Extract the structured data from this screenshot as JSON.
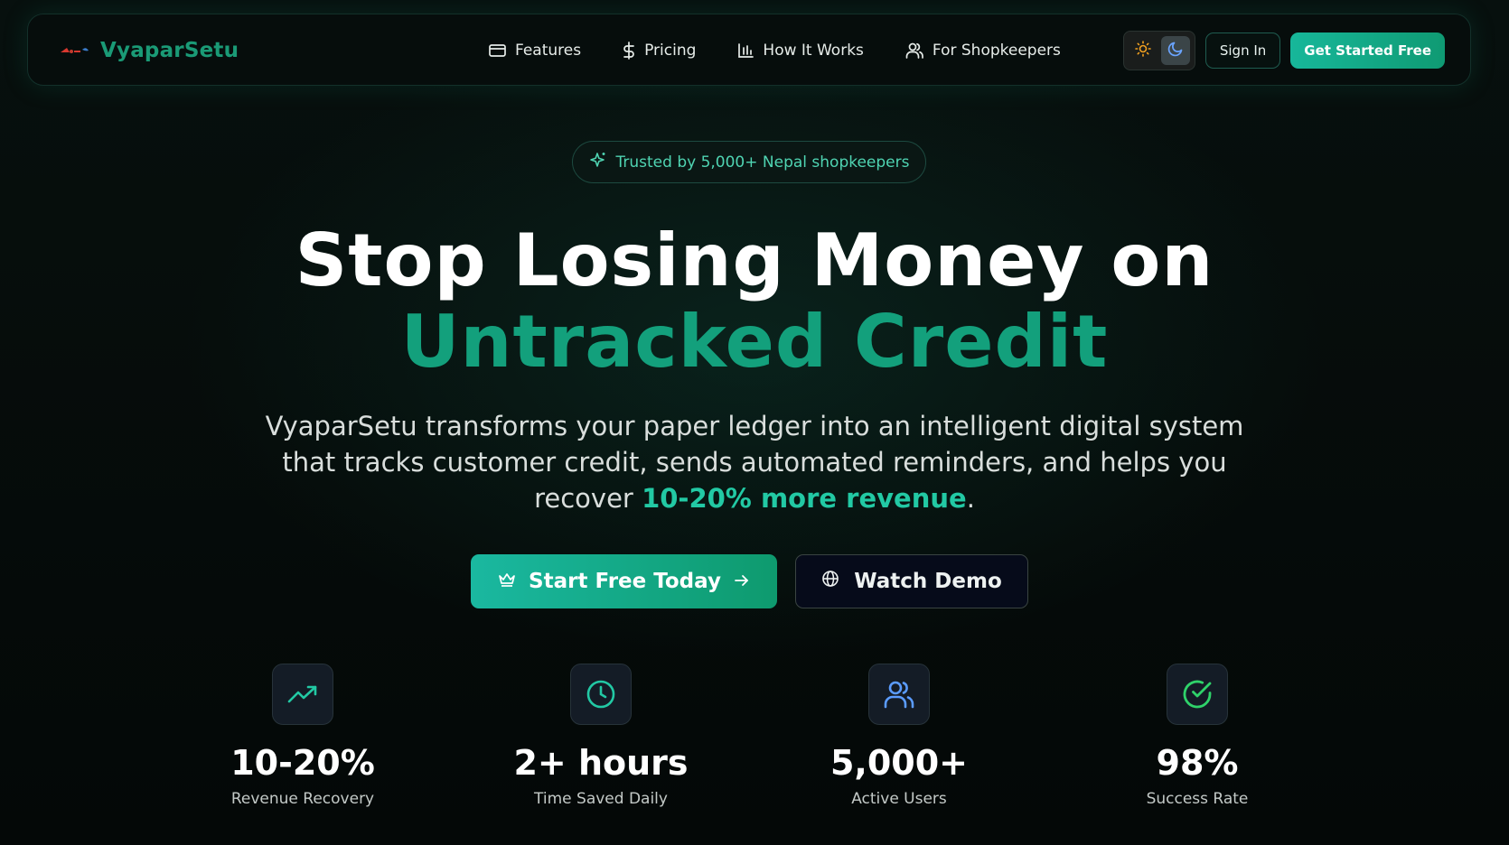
{
  "brand": {
    "name": "VyaparSetu"
  },
  "nav": {
    "items": [
      {
        "label": "Features",
        "icon": "card-icon"
      },
      {
        "label": "Pricing",
        "icon": "dollar-icon"
      },
      {
        "label": "How It Works",
        "icon": "bar-chart-icon"
      },
      {
        "label": "For Shopkeepers",
        "icon": "users-icon"
      }
    ],
    "sign_in": "Sign In",
    "get_started": "Get Started Free",
    "theme_toggle": {
      "active": "dark",
      "options": [
        "sun-icon",
        "moon-icon"
      ]
    }
  },
  "hero": {
    "badge": "Trusted by 5,000+ Nepal shopkeepers",
    "headline_line1": "Stop Losing Money on",
    "headline_line2": "Untracked Credit",
    "subtext_part1": "VyaparSetu transforms your paper ledger into an intelligent digital system that tracks customer credit, sends automated reminders, and helps you recover ",
    "subtext_highlight": "10-20% more revenue",
    "subtext_end": ".",
    "cta_primary": "Start Free Today",
    "cta_secondary": "Watch Demo"
  },
  "stats": [
    {
      "value": "10-20%",
      "label": "Revenue Recovery",
      "icon": "trending-up-icon"
    },
    {
      "value": "2+ hours",
      "label": "Time Saved Daily",
      "icon": "clock-icon"
    },
    {
      "value": "5,000+",
      "label": "Active Users",
      "icon": "users-icon"
    },
    {
      "value": "98%",
      "label": "Success Rate",
      "icon": "check-circle-icon"
    }
  ],
  "colors": {
    "accent": "#13a07c",
    "accent_light": "#22c9a4",
    "background": "#050a09"
  }
}
